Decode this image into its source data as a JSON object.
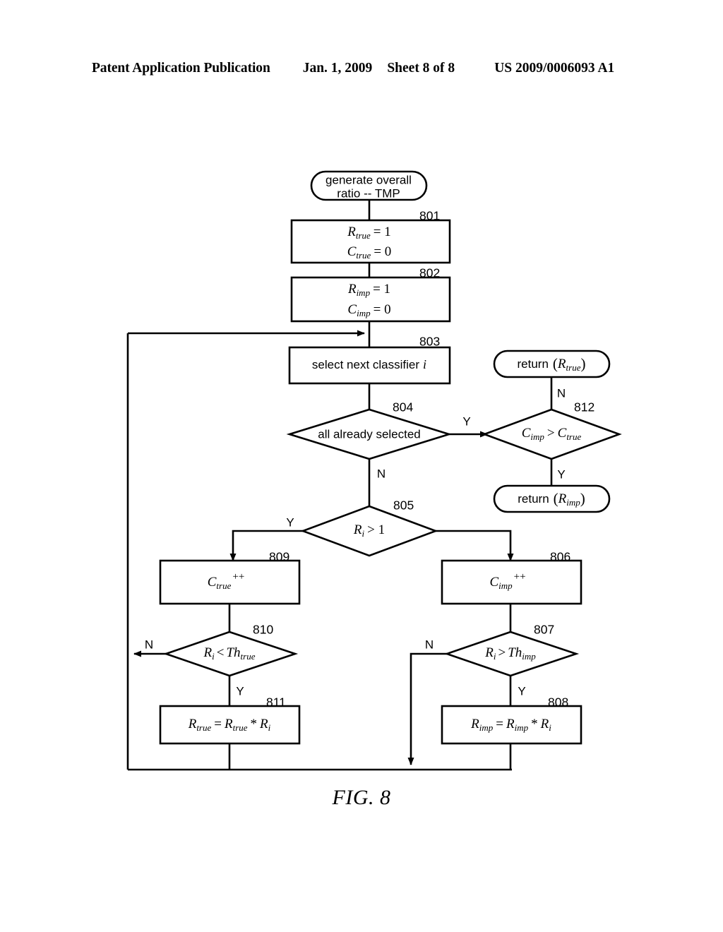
{
  "header": {
    "publication": "Patent Application Publication",
    "date": "Jan. 1, 2009",
    "sheet": "Sheet 8 of 8",
    "patent_number": "US 2009/0006093 A1"
  },
  "figure": {
    "caption": "FIG. 8",
    "nodes": {
      "start": {
        "ref": "",
        "line1": "generate overall",
        "line2": "ratio -- TMP"
      },
      "n801": {
        "ref": "801",
        "line1_var": "R",
        "line1_sub": "true",
        "line1_rest": "= 1",
        "line2_var": "C",
        "line2_sub": "true",
        "line2_rest": "= 0"
      },
      "n802": {
        "ref": "802",
        "line1_var": "R",
        "line1_sub": "imp",
        "line1_rest": "= 1",
        "line2_var": "C",
        "line2_sub": "imp",
        "line2_rest": "= 0"
      },
      "n803": {
        "ref": "803",
        "text": "select next classifier",
        "var": "i"
      },
      "n804": {
        "ref": "804",
        "text": "all already selected"
      },
      "n805": {
        "ref": "805",
        "var": "R",
        "sub": "i",
        "rest": "> 1"
      },
      "n806": {
        "ref": "806",
        "var": "C",
        "sub": "imp",
        "rest": "++"
      },
      "n807": {
        "ref": "807",
        "lhs_var": "R",
        "lhs_sub": "i",
        "op": ">",
        "rhs_var": "Th",
        "rhs_sub": "imp"
      },
      "n808": {
        "ref": "808",
        "text_lhs_var": "R",
        "text_lhs_sub": "imp",
        "eq": "=",
        "text_rhs_var": "R",
        "text_rhs_sub": "imp",
        "star": "*",
        "factor_var": "R",
        "factor_sub": "i"
      },
      "n809": {
        "ref": "809",
        "var": "C",
        "sub": "true",
        "rest": "++"
      },
      "n810": {
        "ref": "810",
        "lhs_var": "R",
        "lhs_sub": "i",
        "op": "<",
        "rhs_var": "Th",
        "rhs_sub": "true"
      },
      "n811": {
        "ref": "811",
        "text_lhs_var": "R",
        "text_lhs_sub": "true",
        "eq": "=",
        "text_rhs_var": "R",
        "text_rhs_sub": "true",
        "star": "*",
        "factor_var": "R",
        "factor_sub": "i"
      },
      "n812": {
        "ref": "812",
        "lhs_var": "C",
        "lhs_sub": "imp",
        "op": ">",
        "rhs_var": "C",
        "rhs_sub": "true"
      },
      "return_true": {
        "ref": "",
        "text": "return",
        "open": "(",
        "var": "R",
        "sub": "true",
        "close": ")"
      },
      "return_imp": {
        "ref": "",
        "text": "return",
        "open": "(",
        "var": "R",
        "sub": "imp",
        "close": ")"
      }
    },
    "edge_labels": {
      "y804": "Y",
      "n804": "N",
      "y805": "Y",
      "n812": "N",
      "y812": "Y",
      "n810": "N",
      "y810": "Y",
      "n807": "N",
      "y807": "Y"
    },
    "colors": {
      "stroke": "#000000",
      "fill": "#ffffff",
      "page": "#ffffff"
    }
  }
}
